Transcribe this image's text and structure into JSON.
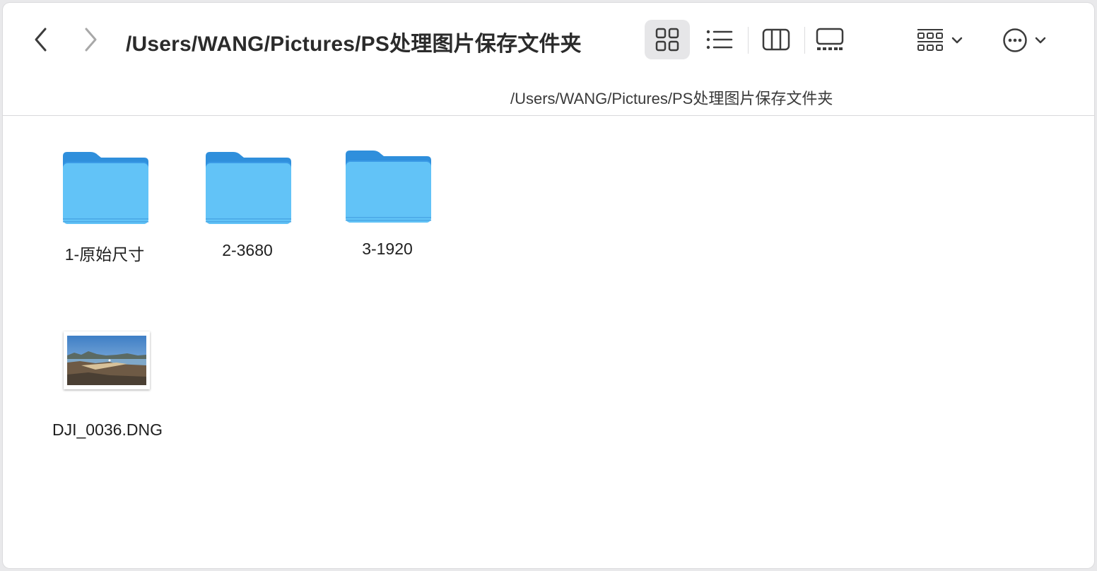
{
  "window": {
    "title": "/Users/WANG/Pictures/PS处理图片保存文件夹",
    "path": "/Users/WANG/Pictures/PS处理图片保存文件夹"
  },
  "toolbar": {
    "back_icon": "chevron-left-icon",
    "forward_icon": "chevron-right-icon",
    "views": [
      {
        "name": "icon-view",
        "icon": "grid-icon",
        "active": true
      },
      {
        "name": "list-view",
        "icon": "list-icon",
        "active": false
      },
      {
        "name": "column-view",
        "icon": "columns-icon",
        "active": false
      },
      {
        "name": "gallery-view",
        "icon": "gallery-icon",
        "active": false
      }
    ],
    "group_icon": "group-grid-icon",
    "more_icon": "ellipsis-circle-icon"
  },
  "items": [
    {
      "name": "1-原始尺寸",
      "kind": "folder"
    },
    {
      "name": "2-3680",
      "kind": "folder"
    },
    {
      "name": "3-1920",
      "kind": "folder"
    },
    {
      "name": "DJI_0036.DNG",
      "kind": "image"
    }
  ],
  "colors": {
    "folder_light": "#62c3f7",
    "folder_dark": "#2f8fdc",
    "selected_view_bg": "#e6e6e8"
  }
}
